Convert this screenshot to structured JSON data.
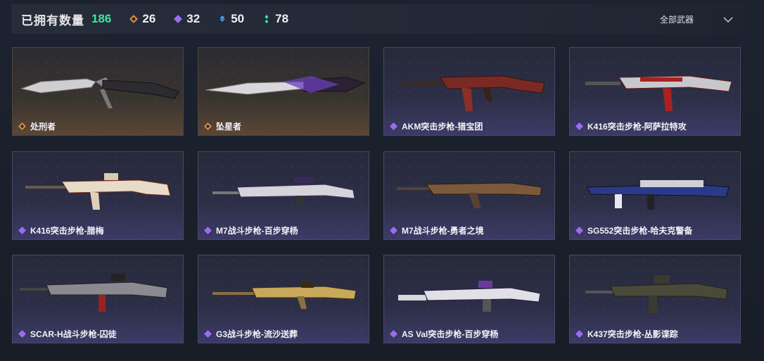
{
  "header": {
    "owned_label": "已拥有数量",
    "owned_count": "186",
    "stats": [
      {
        "icon": "orange-diamond-icon",
        "value": "26",
        "color": "#e08a3c"
      },
      {
        "icon": "purple-diamond-icon",
        "value": "32",
        "color": "#9b6cf0"
      },
      {
        "icon": "blue-diamond-icon",
        "value": "50",
        "color": "#4a9ef0"
      },
      {
        "icon": "green-diamond-icon",
        "value": "78",
        "color": "#3ee6a0"
      }
    ],
    "filter_label": "全部武器"
  },
  "weapons": [
    {
      "name": "处刑者",
      "rarity": "orange"
    },
    {
      "name": "坠星者",
      "rarity": "orange"
    },
    {
      "name": "AKM突击步枪-猎宝团",
      "rarity": "purple"
    },
    {
      "name": "K416突击步枪-阿萨拉特攻",
      "rarity": "purple"
    },
    {
      "name": "K416突击步枪-腊梅",
      "rarity": "purple"
    },
    {
      "name": "M7战斗步枪-百步穿杨",
      "rarity": "purple"
    },
    {
      "name": "M7战斗步枪-勇者之境",
      "rarity": "purple"
    },
    {
      "name": "SG552突击步枪-哈夫克警备",
      "rarity": "purple"
    },
    {
      "name": "SCAR-H战斗步枪-囚徒",
      "rarity": "purple"
    },
    {
      "name": "G3战斗步枪-流沙送葬",
      "rarity": "purple"
    },
    {
      "name": "AS Val突击步枪-百步穿杨",
      "rarity": "purple"
    },
    {
      "name": "K437突击步枪-丛影谍踪",
      "rarity": "purple"
    }
  ]
}
